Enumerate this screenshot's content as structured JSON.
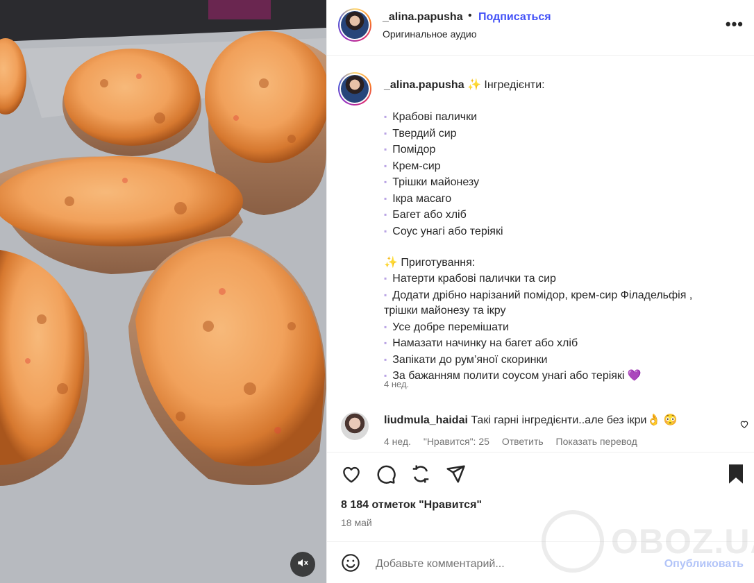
{
  "post": {
    "username": "_alina.papusha",
    "dot": "•",
    "follow_label": "Подписаться",
    "audio_label": "Оригинальное аудио",
    "more_label": "•••"
  },
  "caption": {
    "username": "_alina.papusha",
    "intro": "✨ Інгредієнти:",
    "ingredients": [
      "Крабові палички",
      "Твердий сир",
      "Помідор",
      "Крем-сир",
      "Трішки майонезу",
      "Ікра масаго",
      "Багет або хліб",
      "Соус унагі або теріякі"
    ],
    "prep_title": "✨ Приготування:",
    "steps": [
      "Натерти крабові палички та сир",
      "Додати дрібно нарізаний помідор, крем-сир Філадельфія ,",
      "трішки майонезу та ікру",
      "Усе добре перемішати",
      "Намазати начинку на багет або хліб",
      "Запікати до рум’яної скоринки",
      "За бажанням полити соусом унагі або теріякі 💜"
    ],
    "bullet": "▪",
    "time": "4 нед."
  },
  "comment": {
    "username": "liudmula_haidai",
    "text": "Такі гарні інгредієнти..але без ікри👌 😳",
    "time": "4 нед.",
    "likes_label": "\"Нравится\": 25",
    "reply_label": "Ответить",
    "translate_label": "Показать перевод"
  },
  "stats": {
    "likes": "8 184 отметок \"Нравится\"",
    "date": "18 май"
  },
  "add_comment": {
    "placeholder": "Добавьте комментарий...",
    "post_label": "Опубликовать"
  },
  "watermark": "OBOZ.UA",
  "colors": {
    "link_blue": "#4150f7",
    "post_disabled": "#b2c4f8",
    "bullet_purple": "#b9a4e4",
    "muted": "#737373"
  },
  "icons": {
    "more": "more-dots-icon",
    "like": "heart-icon",
    "comment": "comment-icon",
    "share": "share-icon",
    "send": "send-icon",
    "save": "bookmark-icon",
    "emoji": "emoji-icon",
    "mute": "sound-off-icon"
  }
}
